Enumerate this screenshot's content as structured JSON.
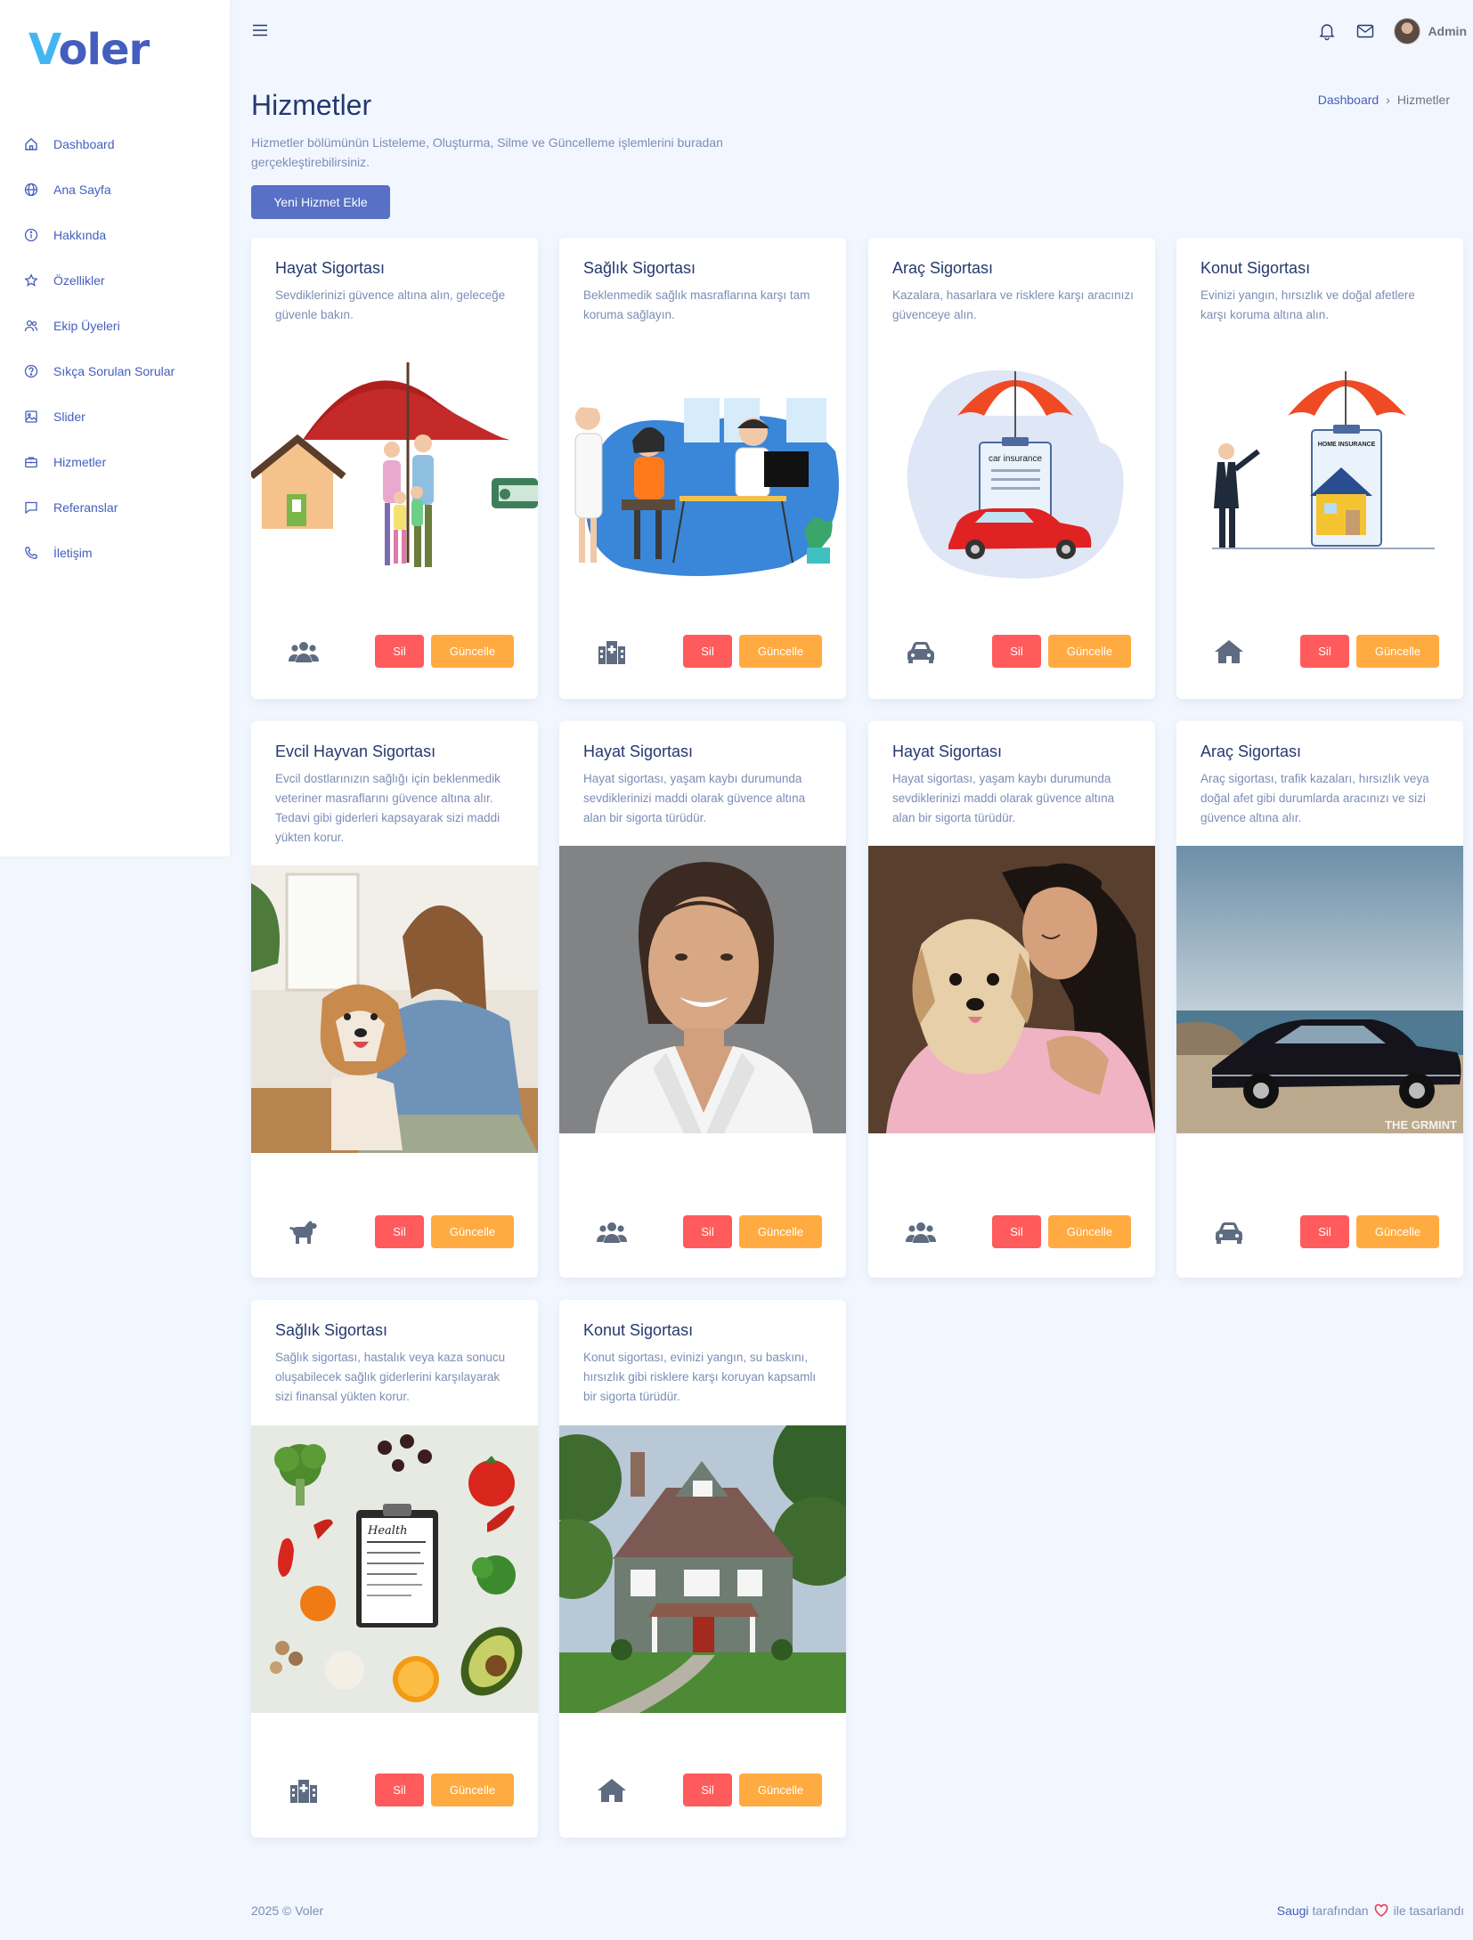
{
  "brand": {
    "logo_first": "V",
    "logo_rest": "oler"
  },
  "sidebar": {
    "items": [
      {
        "label": "Dashboard",
        "icon": "house-icon"
      },
      {
        "label": "Ana Sayfa",
        "icon": "globe-icon"
      },
      {
        "label": "Hakkında",
        "icon": "info-icon"
      },
      {
        "label": "Özellikler",
        "icon": "star-icon"
      },
      {
        "label": "Ekip Üyeleri",
        "icon": "people-icon"
      },
      {
        "label": "Sıkça Sorulan Sorular",
        "icon": "question-icon"
      },
      {
        "label": "Slider",
        "icon": "image-icon"
      },
      {
        "label": "Hizmetler",
        "icon": "briefcase-icon"
      },
      {
        "label": "Referanslar",
        "icon": "chat-icon"
      },
      {
        "label": "İletişim",
        "icon": "phone-icon"
      }
    ]
  },
  "topbar": {
    "user_name": "Admin"
  },
  "header": {
    "title": "Hizmetler",
    "subtitle": "Hizmetler bölümünün Listeleme, Oluşturma, Silme ve Güncelleme işlemlerini buradan gerçekleştirebilirsiniz.",
    "breadcrumb": {
      "home": "Dashboard",
      "current": "Hizmetler"
    },
    "add_button": "Yeni Hizmet Ekle"
  },
  "buttons": {
    "delete": "Sil",
    "update": "Güncelle"
  },
  "cards": [
    {
      "title": "Hayat Sigortası",
      "description": "Sevdiklerinizi güvence altına alın, geleceğe güvenle bakın.",
      "icon": "users-icon"
    },
    {
      "title": "Sağlık Sigortası",
      "description": "Beklenmedik sağlık masraflarına karşı tam koruma sağlayın.",
      "icon": "hospital-icon"
    },
    {
      "title": "Araç Sigortası",
      "description": "Kazalara, hasarlara ve risklere karşı aracınızı güvenceye alın.",
      "icon": "car-icon",
      "image_text": "car insurance"
    },
    {
      "title": "Konut Sigortası",
      "description": "Evinizi yangın, hırsızlık ve doğal afetlere karşı koruma altına alın.",
      "icon": "home-icon",
      "image_text": "HOME INSURANCE"
    },
    {
      "title": "Evcil Hayvan Sigortası",
      "description": "Evcil dostlarınızın sağlığı için beklenmedik veteriner masraflarını güvence altına alır. Tedavi gibi giderleri kapsayarak sizi maddi yükten korur.",
      "icon": "dog-icon"
    },
    {
      "title": "Hayat Sigortası",
      "description": "Hayat sigortası, yaşam kaybı durumunda sevdiklerinizi maddi olarak güvence altına alan bir sigorta türüdür.",
      "icon": "users-icon"
    },
    {
      "title": "Hayat Sigortası",
      "description": "Hayat sigortası, yaşam kaybı durumunda sevdiklerinizi maddi olarak güvence altına alan bir sigorta türüdür.",
      "icon": "users-icon"
    },
    {
      "title": "Araç Sigortası",
      "description": "Araç sigortası, trafik kazaları, hırsızlık veya doğal afet gibi durumlarda aracınızı ve sizi güvence altına alır.",
      "icon": "car-icon",
      "image_text": "THE GRMINT"
    },
    {
      "title": "Sağlık Sigortası",
      "description": "Sağlık sigortası, hastalık veya kaza sonucu oluşabilecek sağlık giderlerini karşılayarak sizi finansal yükten korur.",
      "icon": "hospital-icon",
      "image_text": "Health"
    },
    {
      "title": "Konut Sigortası",
      "description": "Konut sigortası, evinizi yangın, su baskını, hırsızlık gibi risklere karşı koruyan kapsamlı bir sigorta türüdür.",
      "icon": "home-icon"
    }
  ],
  "footer": {
    "copyright": "2025 © Voler",
    "author": "Saugi",
    "by": "tarafından",
    "made": "ile tasarlandı"
  },
  "colors": {
    "primary": "#435ebe",
    "danger": "#ff5b5c",
    "warning": "#ffab41",
    "background": "#f2f7ff"
  }
}
